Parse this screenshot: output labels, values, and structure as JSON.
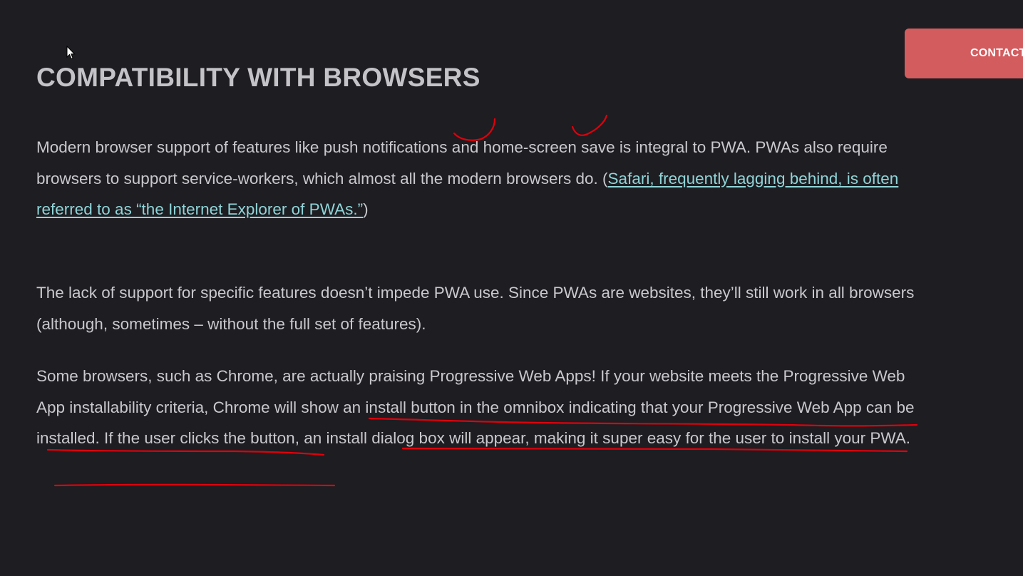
{
  "header": {
    "contact_label": "CONTACT"
  },
  "article": {
    "title": "COMPATIBILITY WITH BROWSERS",
    "paragraph1": {
      "text_before": "Modern browser support of features like push notifications and home-screen save is integral to PWA. PWAs also require browsers to support service-workers, which almost all the modern browsers do. (",
      "link_text": "Safari, frequently lagging behind, is often referred to as “the Internet Explorer of PWAs.”",
      "text_after": ")"
    },
    "paragraph2": "The lack of support for specific features doesn’t impede PWA use. Since PWAs are websites, they’ll still work in all browsers (although, sometimes – without the full set of features).",
    "paragraph3": "Some browsers, such as Chrome, are actually praising Progressive Web Apps! If your website meets the Progressive Web App installability criteria, Chrome will show an install button in the omnibox indicating that your Progressive Web App can be installed. If the user clicks the button, an install dialog box will appear, making it super easy for the user to install your PWA."
  },
  "colors": {
    "background": "#1e1d21",
    "text": "#c9c8cc",
    "link": "#8fd4d8",
    "contact_button": "#d35c5f",
    "annotation": "#e0000c"
  },
  "icons": {
    "cursor": "mouse-pointer-icon"
  }
}
